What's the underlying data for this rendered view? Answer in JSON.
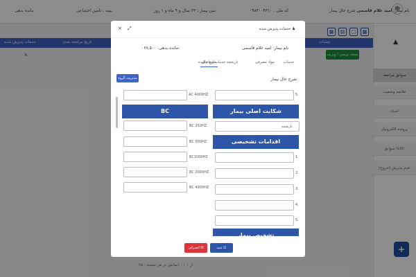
{
  "topbar": {
    "patient_label": "نام بیمار:",
    "patient_name": "امید غلام قاسمی",
    "patient_extra": "شرح حال بیمار",
    "national_id": "کد ملی : ۰۹۸۳۰۰۴۳۱۰",
    "age": "سن بیمار : ۳۳ سال و ۹ ماه و ۱ روز",
    "insurance": "بیمه : تامین اجتماعی",
    "balance": "مانده بدهی : ۰"
  },
  "sidebar": {
    "items": [
      "سوابق مراجعه",
      "خلاصه وضعیت",
      "اسناد",
      "پرونده الکترونیک",
      "سوابق (LIS)",
      "عدم پذیرش (خروج)"
    ]
  },
  "table": {
    "headers": [
      "عملیات",
      "تاریخ مراجعه بعدی",
      "خدمات پذیرش شده"
    ],
    "row_mark": "k",
    "row_action": "نسخه نویسی / ویزیت"
  },
  "footer": {
    "pagination": "۱ - ۱ از ۱",
    "per_page": "نمایش در هر صفحه : ۲۵"
  },
  "modal": {
    "title": "خدمات پذیرش شده",
    "patient_line": "نام بیمار: امید غلام قاسمی",
    "balance_line": "مانده بدهی: ۰۶۷,۵۰۰-",
    "tabs": [
      "خدمات",
      "مواد مصرفی",
      "تاریخچه خدمات انجام شده",
      "شرح حال"
    ],
    "section_title": "شرح حال بیمار",
    "groups_button": "مدیریت گروه ها",
    "right": {
      "five_label": "5.",
      "complaint_header": "شکایت اصلی بیمار",
      "history_label": "تاریخچه",
      "actions_header": "اقدامات تشخیصی",
      "action_numbers": [
        "1.",
        "2.",
        "3.",
        "4.",
        "5."
      ],
      "diagnosis_header": "تشخیص بیمار"
    },
    "left": {
      "ac_label": "AC 4000HZ",
      "bc_header": "BC",
      "bc_labels": [
        "BC 250HZ",
        "BC 500HZ",
        "BC1000HZ",
        "BC 2000HZ",
        "BC 4000HZ"
      ]
    },
    "cancel_button": "انصراف",
    "save_button": "ثبت"
  }
}
